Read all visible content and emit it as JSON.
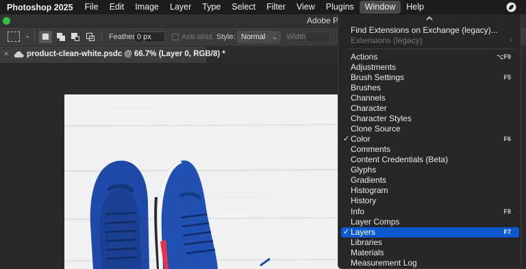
{
  "menubar": {
    "app_name": "Photoshop 2025",
    "items": [
      "File",
      "Edit",
      "Image",
      "Layer",
      "Type",
      "Select",
      "Filter",
      "View",
      "Plugins",
      "Window",
      "Help"
    ],
    "active_item": "Window"
  },
  "titlebar": {
    "title": "Adobe P"
  },
  "options_bar": {
    "feather_label": "Feather:",
    "feather_value": "0 px",
    "antialias_label": "Anti-alias",
    "style_label": "Style:",
    "style_value": "Normal",
    "width_label": "Width:"
  },
  "document_tab": {
    "close_glyph": "×",
    "name": "product-clean-white.psdc @ 66.7% (Layer 0, RGB/8) *"
  },
  "window_menu": {
    "find_extensions": "Find Extensions on Exchange (legacy)...",
    "extensions_legacy": "Extensions (legacy)",
    "items": [
      {
        "label": "Actions",
        "shortcut": "⌥F9",
        "checked": false
      },
      {
        "label": "Adjustments",
        "shortcut": "",
        "checked": false
      },
      {
        "label": "Brush Settings",
        "shortcut": "F5",
        "checked": false
      },
      {
        "label": "Brushes",
        "shortcut": "",
        "checked": false
      },
      {
        "label": "Channels",
        "shortcut": "",
        "checked": false
      },
      {
        "label": "Character",
        "shortcut": "",
        "checked": false
      },
      {
        "label": "Character Styles",
        "shortcut": "",
        "checked": false
      },
      {
        "label": "Clone Source",
        "shortcut": "",
        "checked": false
      },
      {
        "label": "Color",
        "shortcut": "F6",
        "checked": true
      },
      {
        "label": "Comments",
        "shortcut": "",
        "checked": false
      },
      {
        "label": "Content Credentials (Beta)",
        "shortcut": "",
        "checked": false
      },
      {
        "label": "Glyphs",
        "shortcut": "",
        "checked": false
      },
      {
        "label": "Gradients",
        "shortcut": "",
        "checked": false
      },
      {
        "label": "Histogram",
        "shortcut": "",
        "checked": false
      },
      {
        "label": "History",
        "shortcut": "",
        "checked": false
      },
      {
        "label": "Info",
        "shortcut": "F8",
        "checked": false
      },
      {
        "label": "Layer Comps",
        "shortcut": "",
        "checked": false
      },
      {
        "label": "Layers",
        "shortcut": "F7",
        "checked": true,
        "highlighted": true
      },
      {
        "label": "Libraries",
        "shortcut": "",
        "checked": false
      },
      {
        "label": "Materials",
        "shortcut": "",
        "checked": false
      },
      {
        "label": "Measurement Log",
        "shortcut": "",
        "checked": false
      }
    ],
    "check_glyph": "✓",
    "submenu_arrow": "›"
  },
  "colors": {
    "highlight": "#0d5ad0",
    "sneaker_blue": "#1f49a8",
    "sole_red": "#e8344a",
    "traffic_green": "#2fc341"
  }
}
